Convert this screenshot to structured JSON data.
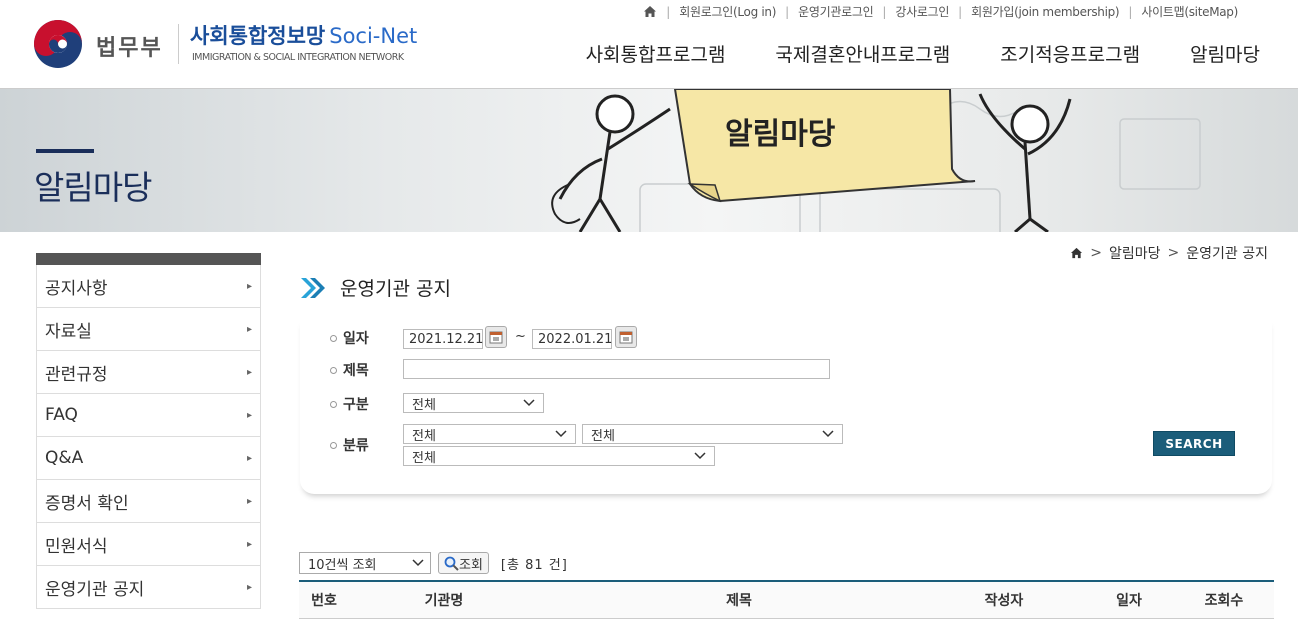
{
  "header": {
    "ministry": "법무부",
    "brand_title": "사회통합정보망",
    "brand_title_en": "Soci-Net",
    "brand_sub": "IMMIGRATION & SOCIAL INTEGRATION NETWORK",
    "util_links": [
      "회원로그인(Log in)",
      "운영기관로그인",
      "강사로그인",
      "회원가입(join membership)",
      "사이트맵(siteMap)"
    ],
    "gnb": [
      "사회통합프로그램",
      "국제결혼안내프로그램",
      "조기적응프로그램",
      "알림마당"
    ]
  },
  "banner": {
    "title": "알림마당",
    "sign_text": "알림마당"
  },
  "lnb": [
    "공지사항",
    "자료실",
    "관련규정",
    "FAQ",
    "Q&A",
    "증명서 확인",
    "민원서식",
    "운영기관 공지"
  ],
  "breadcrumb": [
    "알림마당",
    "운영기관 공지"
  ],
  "page_title": "운영기관 공지",
  "search": {
    "date_label": "일자",
    "date_from": "2021.12.21",
    "date_to": "2022.01.21",
    "tilde": "~",
    "title_label": "제목",
    "title_value": "",
    "type_label": "구분",
    "type_value": "전체",
    "category_label": "분류",
    "category_values": [
      "전체",
      "전체",
      "전체"
    ],
    "button": "SEARCH"
  },
  "list": {
    "page_size": "10건씩 조회",
    "query_button": "조회",
    "total": "[총 81 건]",
    "columns": [
      "번호",
      "기관명",
      "제목",
      "작성자",
      "일자",
      "조회수"
    ]
  },
  "colors": {
    "accent": "#1b5d7a",
    "title_navy": "#1a2e5a",
    "brand_blue": "#1a4e9a"
  }
}
